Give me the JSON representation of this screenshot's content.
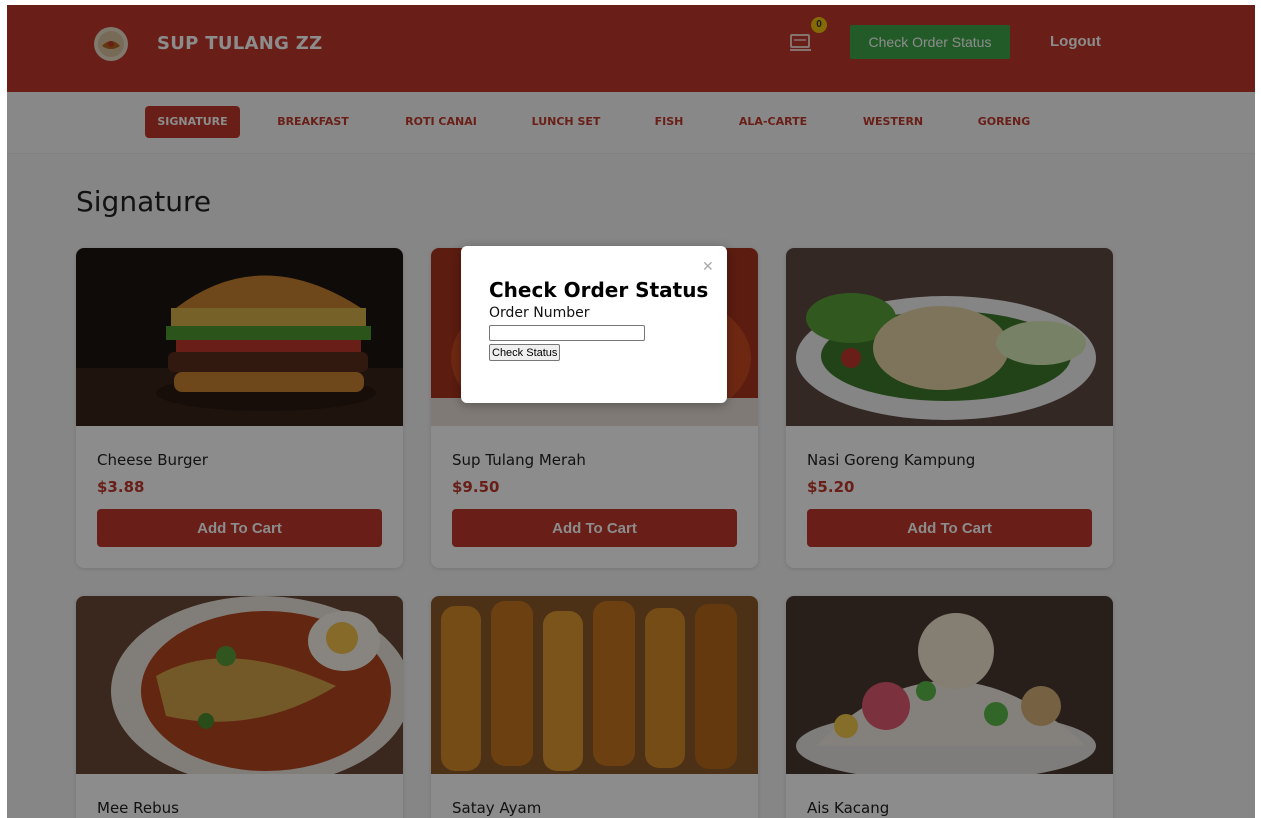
{
  "header": {
    "brand": "SUP TULANG ZZ",
    "cart_count": "0",
    "check_status_label": "Check Order Status",
    "logout_label": "Logout"
  },
  "nav": {
    "items": [
      "SIGNATURE",
      "BREAKFAST",
      "ROTI CANAI",
      "LUNCH SET",
      "FISH",
      "ALA-CARTE",
      "WESTERN",
      "GORENG"
    ],
    "active": "SIGNATURE"
  },
  "section": {
    "title": "Signature"
  },
  "products": [
    {
      "name": "Cheese Burger",
      "price": "$3.88",
      "button": "Add To Cart",
      "image": "cheese-burger-photo"
    },
    {
      "name": "Sup Tulang Merah",
      "price": "$9.50",
      "button": "Add To Cart",
      "image": "sup-tulang-merah-photo"
    },
    {
      "name": "Nasi Goreng Kampung",
      "price": "$5.20",
      "button": "Add To Cart",
      "image": "nasi-goreng-kampung-photo"
    },
    {
      "name": "Mee Rebus",
      "price": "",
      "button": "",
      "image": "mee-rebus-photo"
    },
    {
      "name": "Satay Ayam",
      "price": "",
      "button": "",
      "image": "satay-ayam-photo"
    },
    {
      "name": "Ais Kacang",
      "price": "",
      "button": "",
      "image": "ais-kacang-photo"
    }
  ],
  "modal": {
    "title": "Check Order Status",
    "field_label": "Order Number",
    "input_value": "",
    "button_label": "Check Status",
    "close_icon": "close-icon"
  },
  "colors": {
    "primary": "#c0392b",
    "success": "#3fa74a",
    "badge": "#f1c40f",
    "background": "#f4f4f4"
  }
}
